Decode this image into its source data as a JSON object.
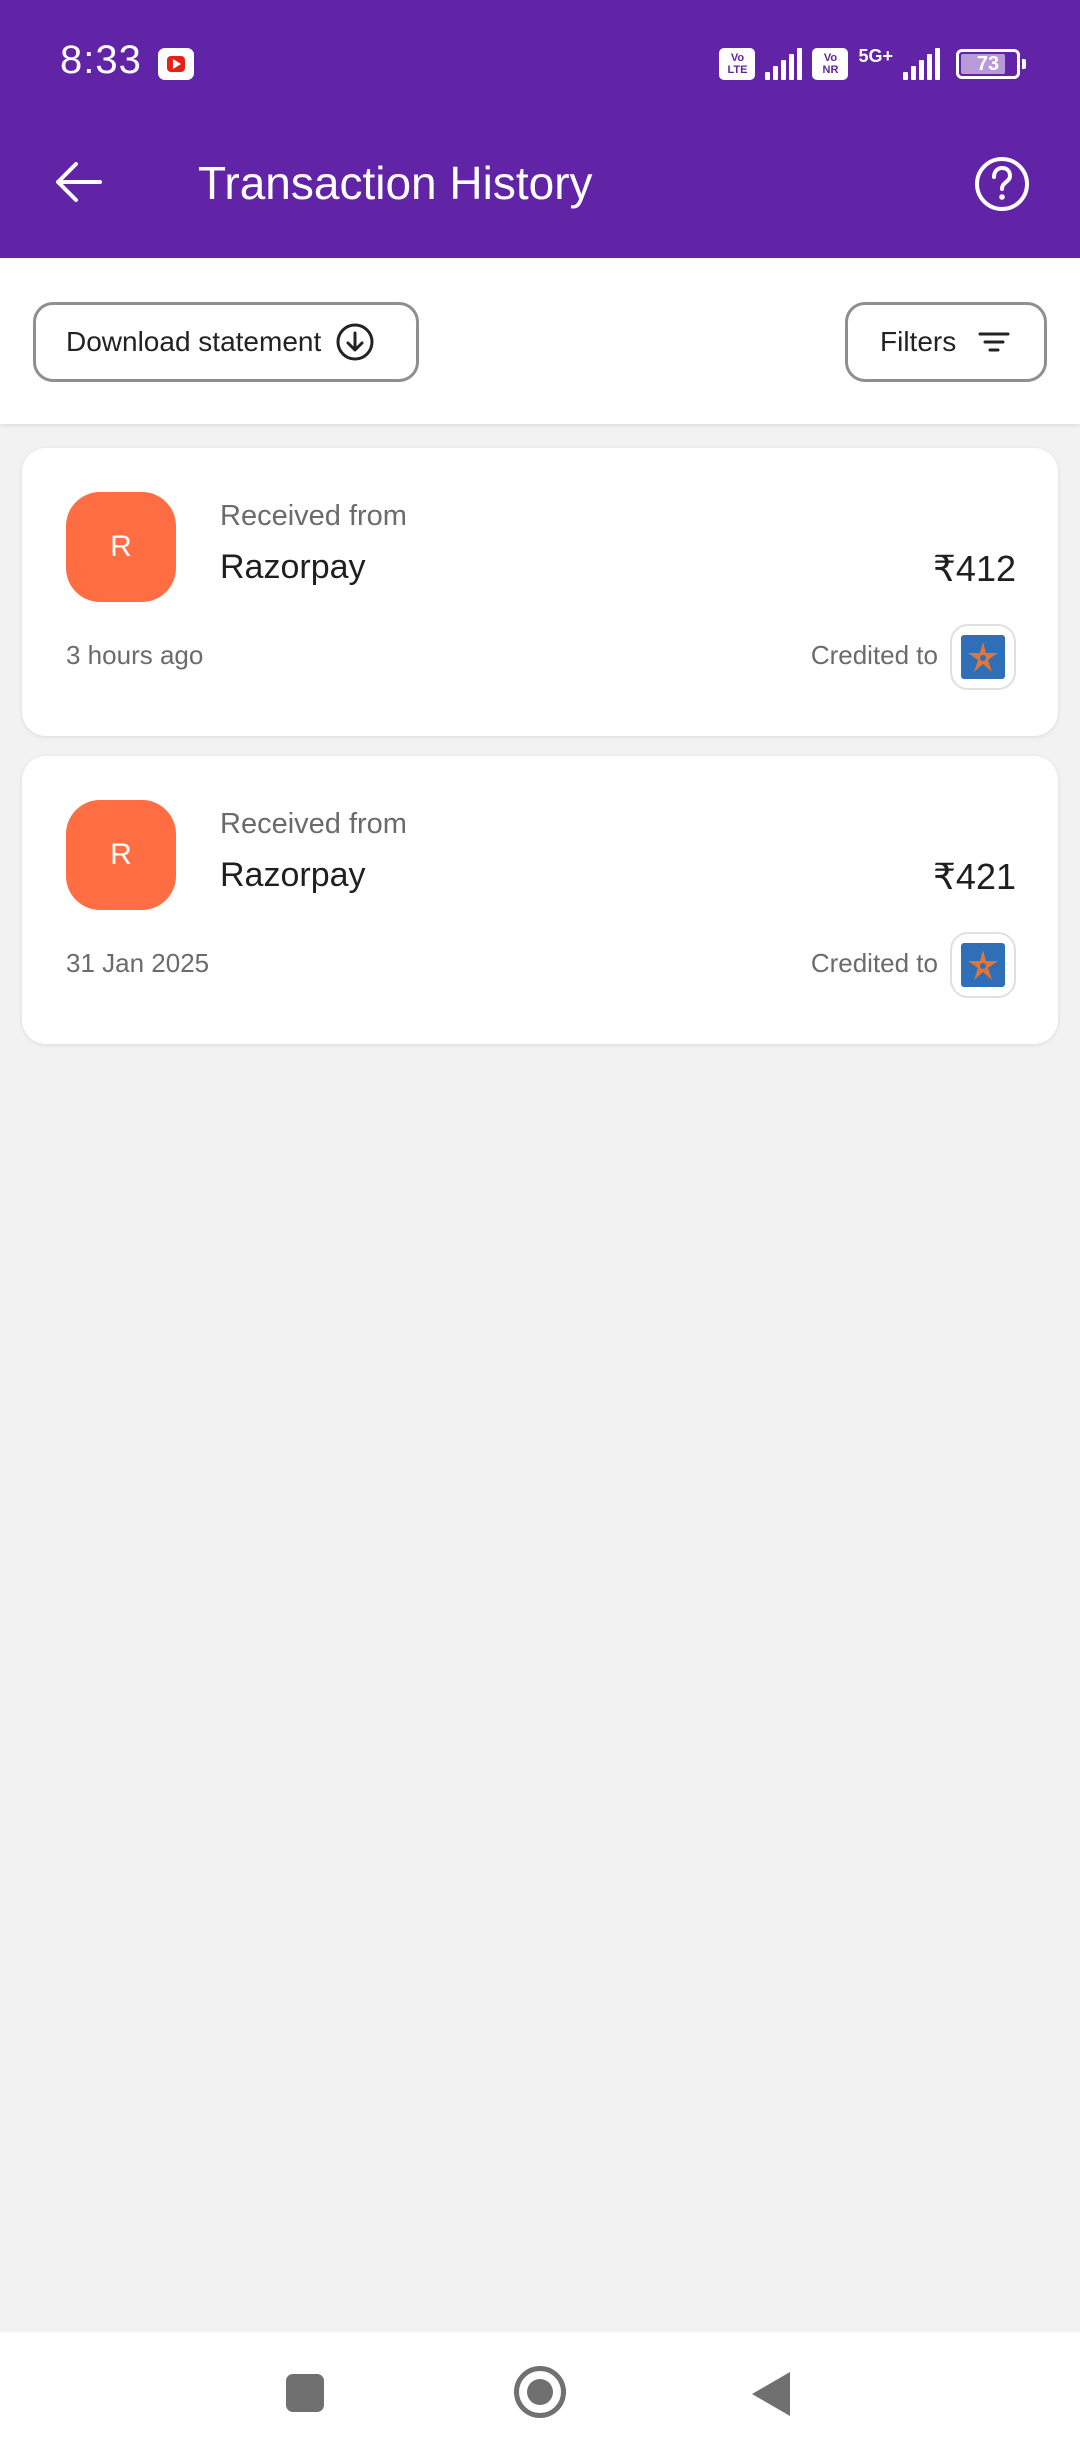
{
  "status_bar": {
    "time": "8:33",
    "notification_icon": "youtube-icon",
    "volte_badge": "Vo LTE",
    "vonr_badge": "Vo NR",
    "network_type": "5G+",
    "battery_level": "73"
  },
  "header": {
    "title": "Transaction History",
    "back_icon": "arrow-left-icon",
    "help_icon": "help-circle-icon",
    "background_color": "#6224a6"
  },
  "actions": {
    "download_label": "Download statement",
    "download_icon": "download-circle-icon",
    "filters_label": "Filters",
    "filters_icon": "filter-lines-icon"
  },
  "transactions": [
    {
      "avatar_letter": "R",
      "direction_label": "Received from",
      "merchant": "Razorpay",
      "amount": "₹412",
      "time": "3 hours ago",
      "credited_label": "Credited to",
      "bank_icon": "bank-logo-icon"
    },
    {
      "avatar_letter": "R",
      "direction_label": "Received from",
      "merchant": "Razorpay",
      "amount": "₹421",
      "time": "31 Jan 2025",
      "credited_label": "Credited to",
      "bank_icon": "bank-logo-icon"
    }
  ],
  "colors": {
    "avatar": "#ff6d42",
    "bank_logo": "#2f6fb8",
    "page_background": "#f2f2f2"
  },
  "navbar": {
    "recents_icon": "square-icon",
    "home_icon": "circle-home-icon",
    "back_icon": "triangle-back-icon"
  }
}
